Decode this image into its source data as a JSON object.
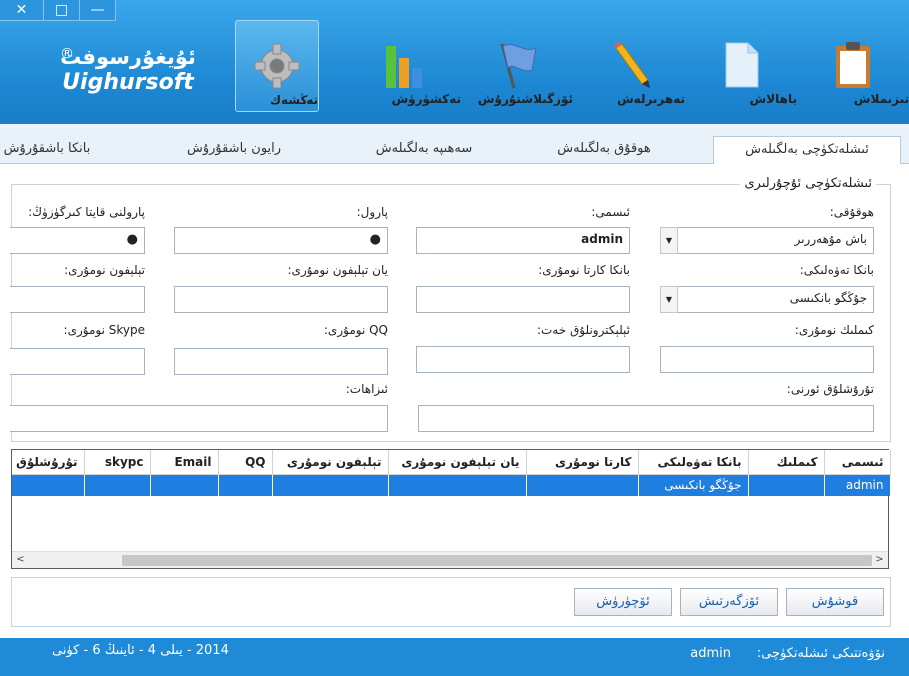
{
  "window": {
    "close": "✕",
    "maximize": "□",
    "minimize": "—"
  },
  "logo": {
    "ar": "ئۇيغۇرسوفت",
    "reg": "®",
    "en": "Uighursoft"
  },
  "toolbar": [
    {
      "label": "تىزىملاش",
      "icon": "clipboard-icon"
    },
    {
      "label": "باھالاش",
      "icon": "document-icon"
    },
    {
      "label": "تەھرىرلەش",
      "icon": "pencil-icon"
    },
    {
      "label": "ئۆزگىلاشتۇرۇش",
      "icon": "flag-icon"
    },
    {
      "label": "تەكشۈرۈش",
      "icon": "bar-chart-icon"
    },
    {
      "label": "تەڭشەك",
      "icon": "gear-icon"
    }
  ],
  "tabs": [
    {
      "label": "ئىشلەتكۈچى بەلگىلەش"
    },
    {
      "label": "ھوقۇق بەلگىلەش"
    },
    {
      "label": "سەھىپە بەلگىلەش"
    },
    {
      "label": "رايون باشقۇرۇش"
    },
    {
      "label": "بانكا باشقۇرۇش"
    }
  ],
  "form": {
    "title": "ئىشلەتكۈچى ئۇچۇرلىرى",
    "permission_label": "ھوقۇقى:",
    "permission_value": "باش مۇھەررىر",
    "name_label": "ئىسمى:",
    "name_value": "admin",
    "password_label": "پارول:",
    "password_value": "●",
    "password_confirm_label": "پارولنى قايتا كىرگۈزۈڭ:",
    "password_confirm_value": "●",
    "bank_label": "بانكا تەۋەلىكى:",
    "bank_value": "جۇڭگو بانكىسى",
    "card_label": "بانكا كارتا نومۇرى:",
    "mobile_label": "يان تېلېفون نومۇرى:",
    "phone_label": "تېلېفون نومۇرى:",
    "id_label": "كىملىك نومۇرى:",
    "email_label": "ئېلېكترونلۇق خەت:",
    "qq_label": "QQ نومۇرى:",
    "skype_label": "Skype نومۇرى:",
    "address_label": "تۇرۇشلۇق ئورنى:",
    "note_label": "ئىزاھات:"
  },
  "grid": {
    "columns": [
      "ئىسمى",
      "كىملىك",
      "بانكا تەۋەلىكى",
      "كارتا نومۇرى",
      "يان تېلېفون نومۇرى",
      "تېلېفون نومۇرى",
      "QQ",
      "Email",
      "skypc",
      "تۇرۇشلۇق ئورنى"
    ],
    "rows": [
      [
        "admin",
        "",
        "جۇڭگو بانكىسى",
        "",
        "",
        "",
        "",
        "",
        "",
        ""
      ]
    ],
    "scroll_left": "<",
    "scroll_right": ">"
  },
  "buttons": {
    "add": "قوشۇش",
    "edit": "ئۆزگەرتىش",
    "delete": "ئۆچۈرۈش"
  },
  "status": {
    "user_label": "نۆۋەتتىكى ئىشلەتكۈچى:",
    "user_value": "admin",
    "date": "2014 - يىلى 4 - ئاينىڭ 6 - كۈنى"
  }
}
